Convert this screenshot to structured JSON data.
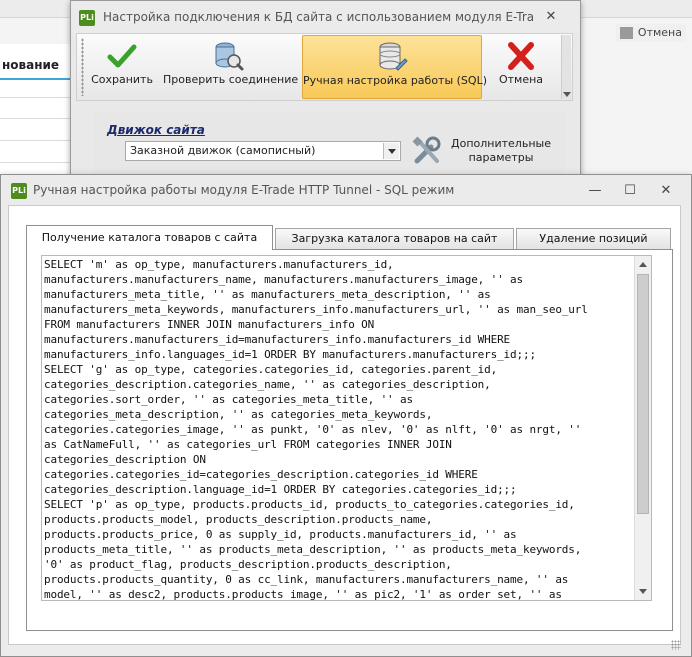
{
  "background": {
    "cancel_label": "Отмена",
    "column_header": "нование"
  },
  "connection_window": {
    "icon_text": "PLi",
    "title": "Настройка подключения к БД сайта с использованием модуля E-Trade HTT...",
    "close_glyph": "✕",
    "toolbar": {
      "save_label": "Сохранить",
      "check_label": "Проверить соединение",
      "manual_label": "Ручная настройка работы (SQL)",
      "cancel_label": "Отмена"
    },
    "engine": {
      "label": "Движок сайта",
      "selected": "Заказной движок (самописный)",
      "extra_params_label": "Дополнительные параметры"
    }
  },
  "sql_window": {
    "icon_text": "PLi",
    "title": "Ручная настройка работы модуля E-Trade HTTP Tunnel - SQL режим",
    "min_glyph": "—",
    "max_glyph": "☐",
    "close_glyph": "✕",
    "tabs": [
      {
        "label": "Получение каталога товаров с сайта",
        "active": true
      },
      {
        "label": "Загрузка каталога товаров на сайт",
        "active": false
      },
      {
        "label": "Удаление позиций",
        "active": false
      }
    ],
    "sql_text": "SELECT 'm' as op_type, manufacturers.manufacturers_id,\nmanufacturers.manufacturers_name, manufacturers.manufacturers_image, '' as\nmanufacturers_meta_title, '' as manufacturers_meta_description, '' as\nmanufacturers_meta_keywords, manufacturers_info.manufacturers_url, '' as man_seo_url\nFROM manufacturers INNER JOIN manufacturers_info ON\nmanufacturers.manufacturers_id=manufacturers_info.manufacturers_id WHERE\nmanufacturers_info.languages_id=1 ORDER BY manufacturers.manufacturers_id;;;\nSELECT 'g' as op_type, categories.categories_id, categories.parent_id,\ncategories_description.categories_name, '' as categories_description,\ncategories.sort_order, '' as categories_meta_title, '' as\ncategories_meta_description, '' as categories_meta_keywords,\ncategories.categories_image, '' as punkt, '0' as nlev, '0' as nlft, '0' as nrgt, ''\nas CatNameFull, '' as categories_url FROM categories INNER JOIN\ncategories_description ON\ncategories.categories_id=categories_description.categories_id WHERE\ncategories_description.language_id=1 ORDER BY categories.categories_id;;;\nSELECT 'p' as op_type, products.products_id, products_to_categories.categories_id,\nproducts.products_model, products_description.products_name,\nproducts.products_price, 0 as supply_id, products.manufacturers_id, '' as\nproducts_meta_title, '' as products_meta_description, '' as products_meta_keywords,\n'0' as product_flag, products_description.products_description,\nproducts.products_quantity, 0 as cc_link, manufacturers.manufacturers_name, '' as\nmodel, '' as desc2, products.products_image, '' as pic2, '1' as order_set, '' as"
  }
}
